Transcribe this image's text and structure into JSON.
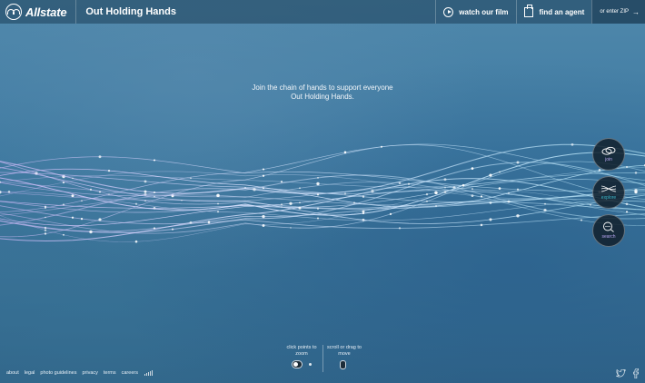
{
  "header": {
    "brand": "Allstate",
    "site_title": "Out Holding Hands",
    "watch_film": "watch our film",
    "find_agent": "find an agent",
    "zip_prompt": "or enter ZIP"
  },
  "headline": {
    "line1": "Join the chain of hands to support everyone",
    "line2": "Out Holding Hands."
  },
  "side_actions": {
    "join": "join",
    "explore": "explore",
    "search": "search"
  },
  "hints": {
    "zoom_line1": "click points to",
    "zoom_line2": "zoom",
    "drag_line1": "scroll or drag to",
    "drag_line2": "move"
  },
  "footer": {
    "links": [
      "about",
      "legal",
      "photo guidelines",
      "privacy",
      "terms",
      "careers"
    ]
  },
  "social": [
    "twitter-icon",
    "facebook-icon"
  ],
  "colors": {
    "background": "#3f7aa2",
    "header_bar": "#1c3e58",
    "strand": "#c9d8ff",
    "accent_lavender": "#b9a6f2",
    "button_dark": "#12202c"
  }
}
